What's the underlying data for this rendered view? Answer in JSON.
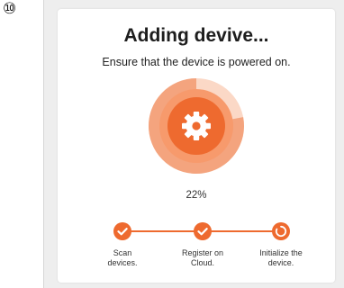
{
  "step_marker": "⑩",
  "dialog": {
    "title": "Adding devive...",
    "subtitle": "Ensure that the device is powered on."
  },
  "progress": {
    "value": 0.22,
    "label": "22%",
    "icon": "gear-icon"
  },
  "steps": [
    {
      "label_line1": "Scan",
      "label_line2": "devices.",
      "state": "done",
      "icon": "check-icon"
    },
    {
      "label_line1": "Register on",
      "label_line2": "Cloud.",
      "state": "done",
      "icon": "check-icon"
    },
    {
      "label_line1": "Initialize the",
      "label_line2": "device.",
      "state": "in-progress",
      "icon": "spinner-icon"
    }
  ],
  "colors": {
    "accent": "#ee6a2f",
    "accent_light": "#fbd8c6",
    "accent_mid": "#f4a47e"
  }
}
